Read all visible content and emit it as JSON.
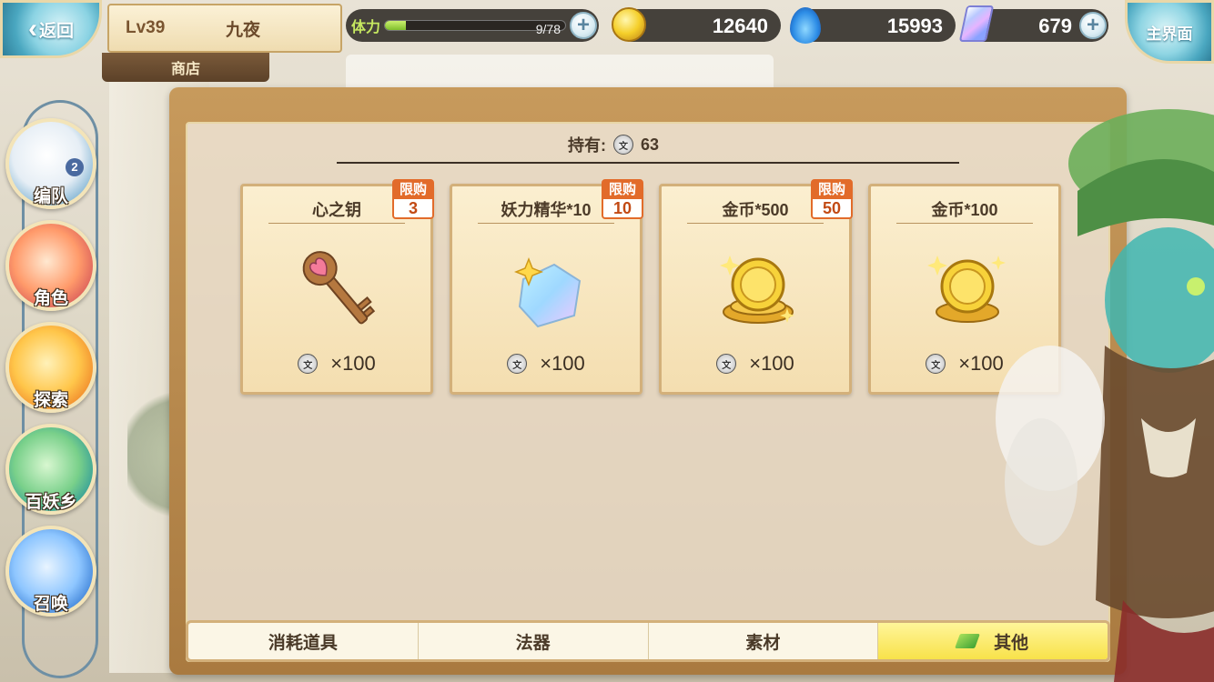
{
  "header": {
    "back_label": "返回",
    "level": "Lv39",
    "player_name": "九夜",
    "section": "商店",
    "main_label": "主界面"
  },
  "resources": {
    "stamina_label": "体力",
    "stamina_value": "9/78",
    "stamina_fraction": 0.115,
    "gold": "12640",
    "soul": "15993",
    "gem": "679"
  },
  "nav": {
    "team": "编队",
    "team_badge": "2",
    "role": "角色",
    "explore": "探索",
    "village": "百妖乡",
    "summon": "召唤"
  },
  "shop": {
    "holding_label": "持有:",
    "holding_value": "63",
    "token_glyph": "文",
    "items": [
      {
        "title": "心之钥",
        "limit_label": "限购",
        "limit": "3",
        "price": "×100",
        "icon": "heart-key-icon"
      },
      {
        "title": "妖力精华*10",
        "limit_label": "限购",
        "limit": "10",
        "price": "×100",
        "icon": "crystal-essence-icon"
      },
      {
        "title": "金币*500",
        "limit_label": "限购",
        "limit": "50",
        "price": "×100",
        "icon": "gold-coin-stack-icon"
      },
      {
        "title": "金币*100",
        "price": "×100",
        "icon": "gold-coin-stack-icon"
      }
    ],
    "tabs": [
      {
        "label": "消耗道具"
      },
      {
        "label": "法器"
      },
      {
        "label": "素材"
      },
      {
        "label": "其他"
      }
    ]
  },
  "colors": {
    "accent": "#e26b2a",
    "frame": "#c79a5c",
    "active_tab": "#f8e24a"
  }
}
